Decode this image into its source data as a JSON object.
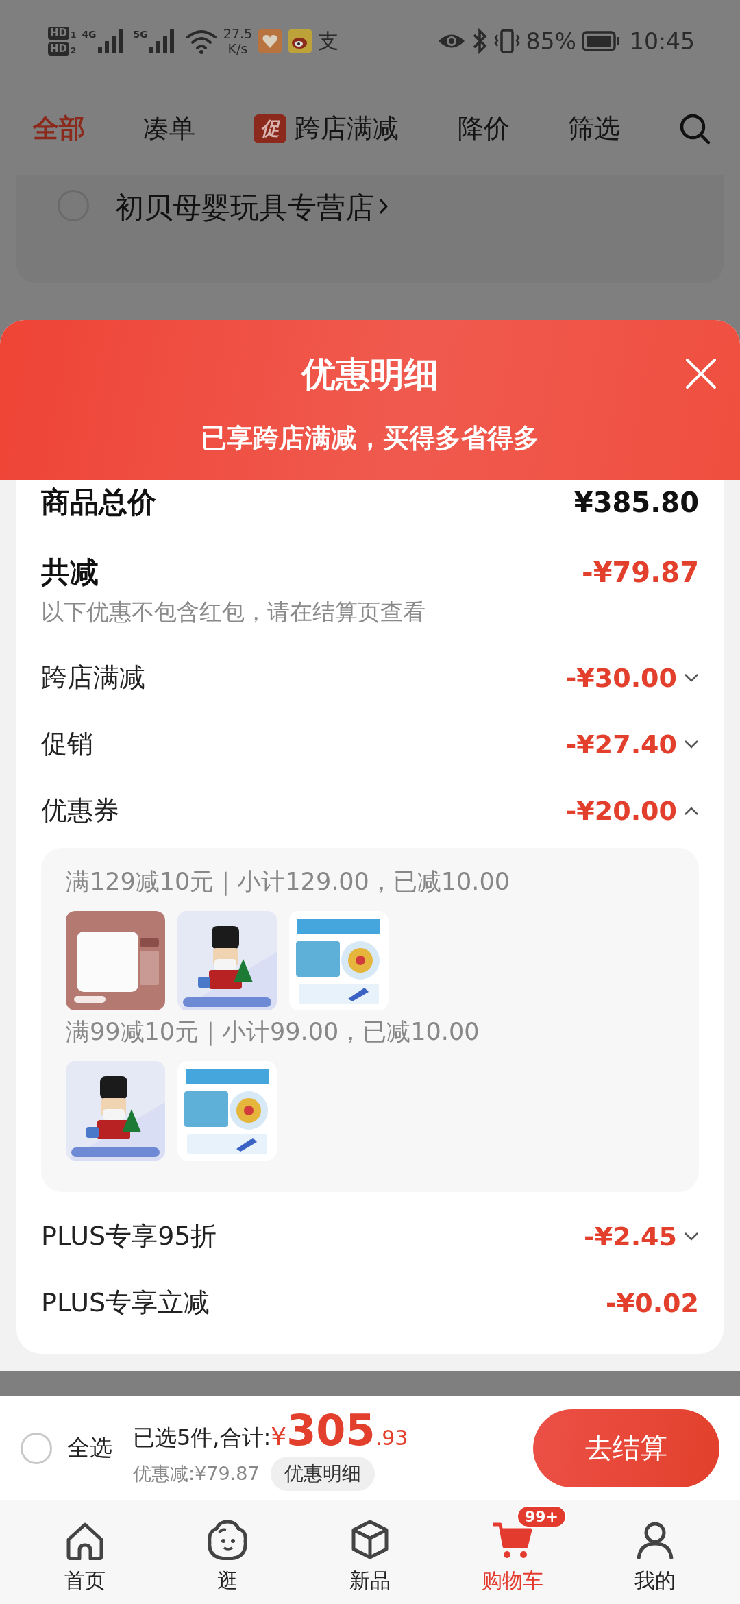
{
  "status_bar": {
    "sims": [
      {
        "label": "HD",
        "slot": "1"
      },
      {
        "label": "HD",
        "slot": "2"
      }
    ],
    "networks": [
      "4G",
      "5G"
    ],
    "speed_value": "27.5",
    "speed_unit": "K/s",
    "app_glyph": "支",
    "battery": "85%",
    "time": "10:45"
  },
  "tabs": [
    {
      "label": "全部",
      "selected": true
    },
    {
      "label": "凑单",
      "selected": false
    },
    {
      "label": "跨店满减",
      "selected": false,
      "badge": "促"
    },
    {
      "label": "降价",
      "selected": false
    },
    {
      "label": "筛选",
      "selected": false
    }
  ],
  "store": {
    "name": "初贝母婴玩具专营店",
    "checked": false
  },
  "sheet": {
    "title": "优惠明细",
    "subtitle": "已享跨店满减，买得多省得多",
    "total": {
      "label": "商品总价",
      "value": "¥385.80"
    },
    "discount": {
      "label": "共减",
      "value": "-¥79.87",
      "note": "以下优惠不包含红包，请在结算页查看"
    },
    "rows": [
      {
        "kind": "expandable",
        "label": "跨店满减",
        "value": "-¥30.00",
        "expanded": false
      },
      {
        "kind": "expandable",
        "label": "促销",
        "value": "-¥27.40",
        "expanded": false
      },
      {
        "kind": "expandable",
        "label": "优惠券",
        "value": "-¥20.00",
        "expanded": true,
        "groups": [
          {
            "title": "满129减10元｜小计129.00，已减10.00"
          },
          {
            "title": "满99减10元｜小计99.00，已减10.00"
          }
        ]
      },
      {
        "kind": "expandable",
        "label": "PLUS专享95折",
        "value": "-¥2.45",
        "expanded": false
      },
      {
        "kind": "plain",
        "label": "PLUS专享立减",
        "value": "-¥0.02"
      }
    ]
  },
  "checkout": {
    "select_all": "全选",
    "checked": false,
    "summary": "已选5件,合计:",
    "currency": "¥",
    "amount_main": "305",
    "amount_cents": ".93",
    "saved": "优惠减:¥79.87",
    "detail_button": "优惠明细",
    "button": "去结算"
  },
  "nav": [
    {
      "label": "首页",
      "selected": false
    },
    {
      "label": "逛",
      "selected": false
    },
    {
      "label": "新品",
      "selected": false
    },
    {
      "label": "购物车",
      "selected": true,
      "badge": "99+"
    },
    {
      "label": "我的",
      "selected": false
    }
  ]
}
